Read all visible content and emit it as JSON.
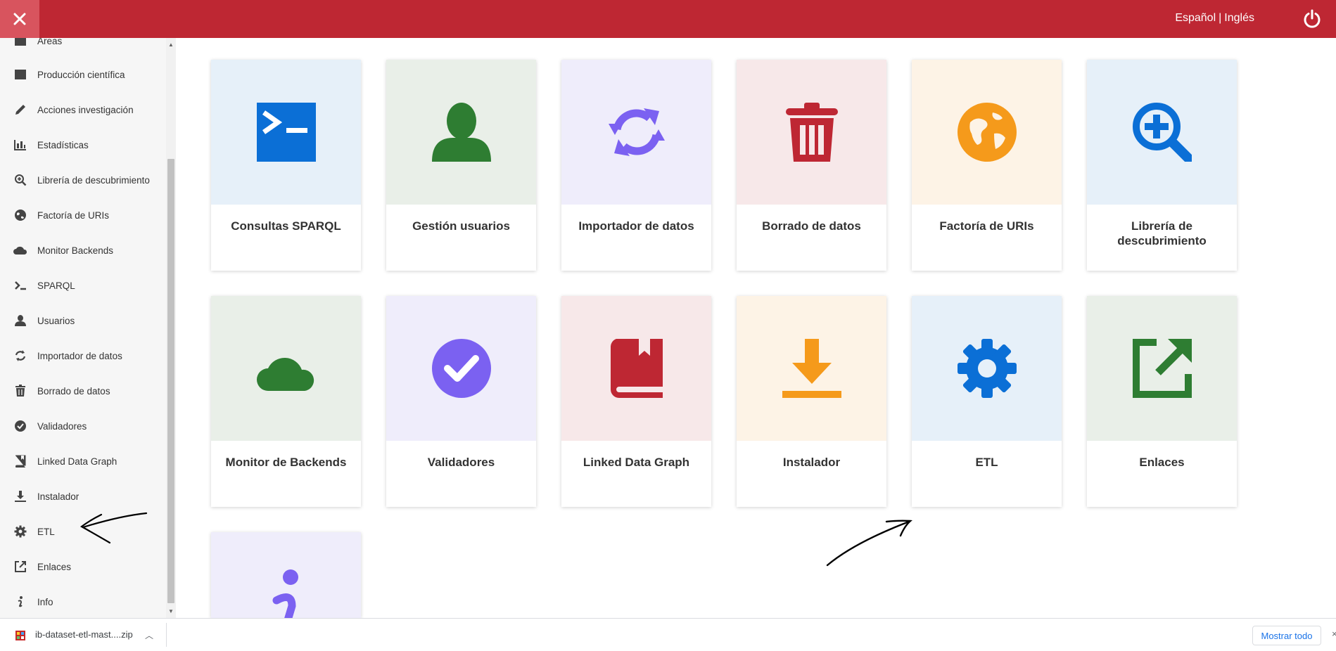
{
  "header": {
    "close_icon": "close-icon",
    "lang_es": "Español",
    "lang_sep": "|",
    "lang_en": "Inglés",
    "power_icon": "power-icon",
    "bg_color": "#be2733"
  },
  "sidebar": {
    "items": [
      {
        "label": "Áreas",
        "icon": "folder-icon"
      },
      {
        "label": "Producción científica",
        "icon": "folder-icon"
      },
      {
        "label": "Acciones investigación",
        "icon": "pencil-icon"
      },
      {
        "label": "Estadísticas",
        "icon": "bar-chart-icon"
      },
      {
        "label": "Librería de descubrimiento",
        "icon": "search-plus-icon"
      },
      {
        "label": "Factoría de URIs",
        "icon": "globe-icon"
      },
      {
        "label": "Monitor Backends",
        "icon": "cloud-icon"
      },
      {
        "label": "SPARQL",
        "icon": "terminal-icon"
      },
      {
        "label": "Usuarios",
        "icon": "user-icon"
      },
      {
        "label": "Importador de datos",
        "icon": "sync-icon"
      },
      {
        "label": "Borrado de datos",
        "icon": "trash-icon"
      },
      {
        "label": "Validadores",
        "icon": "check-circle-icon"
      },
      {
        "label": "Linked Data Graph",
        "icon": "book-icon"
      },
      {
        "label": "Instalador",
        "icon": "download-icon"
      },
      {
        "label": "ETL",
        "icon": "gear-icon"
      },
      {
        "label": "Enlaces",
        "icon": "external-link-icon"
      },
      {
        "label": "Info",
        "icon": "info-icon"
      }
    ]
  },
  "cards": [
    {
      "title": "Consultas SPARQL",
      "icon": "terminal-icon",
      "bg": "#e6f0f9",
      "color": "#0b6fd6"
    },
    {
      "title": "Gestión usuarios",
      "icon": "user-icon",
      "bg": "#e9efe8",
      "color": "#2e7d32"
    },
    {
      "title": "Importador de datos",
      "icon": "sync-icon",
      "bg": "#efedfb",
      "color": "#7b61f1"
    },
    {
      "title": "Borrado de datos",
      "icon": "trash-icon",
      "bg": "#f7e8e9",
      "color": "#be2733"
    },
    {
      "title": "Factoría de URIs",
      "icon": "globe-icon",
      "bg": "#fdf3e6",
      "color": "#f59a1b"
    },
    {
      "title": "Librería de descubrimiento",
      "icon": "search-plus-icon",
      "bg": "#e6f0f9",
      "color": "#0b6fd6"
    },
    {
      "title": "Monitor de Backends",
      "icon": "cloud-icon",
      "bg": "#e9efe8",
      "color": "#2e7d32"
    },
    {
      "title": "Validadores",
      "icon": "check-circle-icon",
      "bg": "#efedfb",
      "color": "#7b61f1"
    },
    {
      "title": "Linked Data Graph",
      "icon": "book-icon",
      "bg": "#f7e8e9",
      "color": "#be2733"
    },
    {
      "title": "Instalador",
      "icon": "download-icon",
      "bg": "#fdf3e6",
      "color": "#f59a1b"
    },
    {
      "title": "ETL",
      "icon": "gear-icon",
      "bg": "#e6f0f9",
      "color": "#0b6fd6"
    },
    {
      "title": "Enlaces",
      "icon": "external-link-icon",
      "bg": "#e9efe8",
      "color": "#2e7d32"
    },
    {
      "title": "",
      "icon": "info-icon",
      "bg": "#efedfb",
      "color": "#7b61f1"
    }
  ],
  "downloads": {
    "file_name": "ib-dataset-etl-mast....zip",
    "file_icon": "file-zip-icon",
    "show_all": "Mostrar todo"
  }
}
